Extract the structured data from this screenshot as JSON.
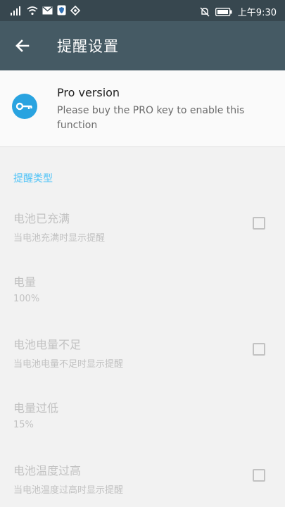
{
  "status_bar": {
    "time": "上午9:30",
    "left_icons": [
      "signal-icon",
      "wifi-icon",
      "mail-icon",
      "shield-icon",
      "app-icon"
    ],
    "right_icons": [
      "mute-icon",
      "battery-icon"
    ]
  },
  "app_bar": {
    "title": "提醒设置",
    "back_icon": "arrow-left-icon",
    "color": "#455a64"
  },
  "pro_card": {
    "title": "Pro version",
    "description": "Please buy the PRO key to enable this function",
    "icon": "key-icon",
    "icon_color": "#29a3e0"
  },
  "section": {
    "title": "提醒类型",
    "color": "#4fc3f7"
  },
  "preferences": [
    {
      "title": "电池已充满",
      "summary": "当电池充满时显示提醒",
      "checkbox": true,
      "checked": false
    },
    {
      "title": "电量",
      "summary": "100%",
      "checkbox": false
    },
    {
      "title": "电池电量不足",
      "summary": "当电池电量不足时显示提醒",
      "checkbox": true,
      "checked": false
    },
    {
      "title": "电量过低",
      "summary": "15%",
      "checkbox": false
    },
    {
      "title": "电池温度过高",
      "summary": "当电池温度过高时显示提醒",
      "checkbox": true,
      "checked": false
    }
  ]
}
